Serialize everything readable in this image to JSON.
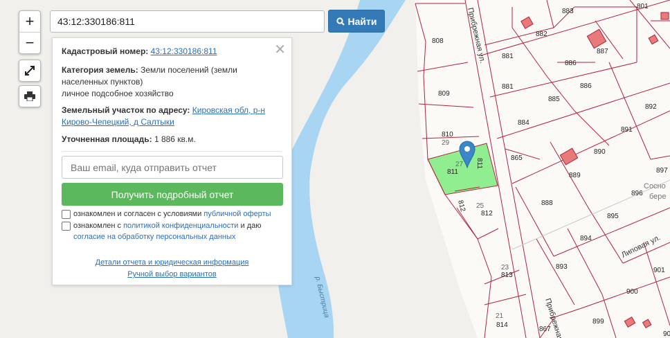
{
  "controls": {
    "zoom_in": "+",
    "zoom_out": "−"
  },
  "search": {
    "value": "43:12:330186:811",
    "button_label": "Найти"
  },
  "popup": {
    "cad_label": "Кадастровый номер:",
    "cad_value": "43:12:330186:811",
    "category_label": "Категория земель:",
    "category_value_1": "Земли поселений (земли",
    "category_value_2": "населенных пунктов)",
    "category_value_3": "личное подсобное хозяйство",
    "address_label": "Земельный участок по адресу:",
    "address_value_1": "Кировская обл, р-н",
    "address_value_2": "Кирово-Чепецкий, д Салтыки",
    "area_label": "Уточненная площадь:",
    "area_value": "1 886 кв.м.",
    "email_placeholder": "Ваш email, куда отправить отчет",
    "report_button": "Получить подробный отчет",
    "agree1_text": "ознакомлен и согласен с условиями",
    "agree1_link": "публичной оферты",
    "agree2_text": "ознакомлен с",
    "agree2_link": "политикой конфиденциальности",
    "agree2_tail": "и даю",
    "agree2_link2": "согласие на обработку персональных данных",
    "details_link": "Детали отчета и юридическая информация",
    "manual_link": "Ручной выбор вариантов"
  },
  "map": {
    "streets": {
      "pribrezhnaya": "Прибрежная ул.",
      "pribrezhnaya2": "Прибрежная",
      "lipovaya": "Липовая ул.",
      "river": "р. Быстрица"
    },
    "place": [
      "Сосно",
      "бере"
    ],
    "parcels": [
      "883",
      "801",
      "808",
      "882",
      "887",
      "881",
      "886",
      "881",
      "886",
      "809",
      "885",
      "892",
      "884",
      "891",
      "810",
      "29",
      "865",
      "890",
      "27",
      "811",
      "811",
      "897",
      "889",
      "896",
      "812",
      "25",
      "812",
      "888",
      "895",
      "894",
      "901",
      "23",
      "813",
      "893",
      "900",
      "21",
      "814",
      "899",
      "867",
      "90"
    ],
    "selected_color": "#90ee90",
    "boundary_color": "#b2223e",
    "river_color": "#a7d5f2"
  }
}
